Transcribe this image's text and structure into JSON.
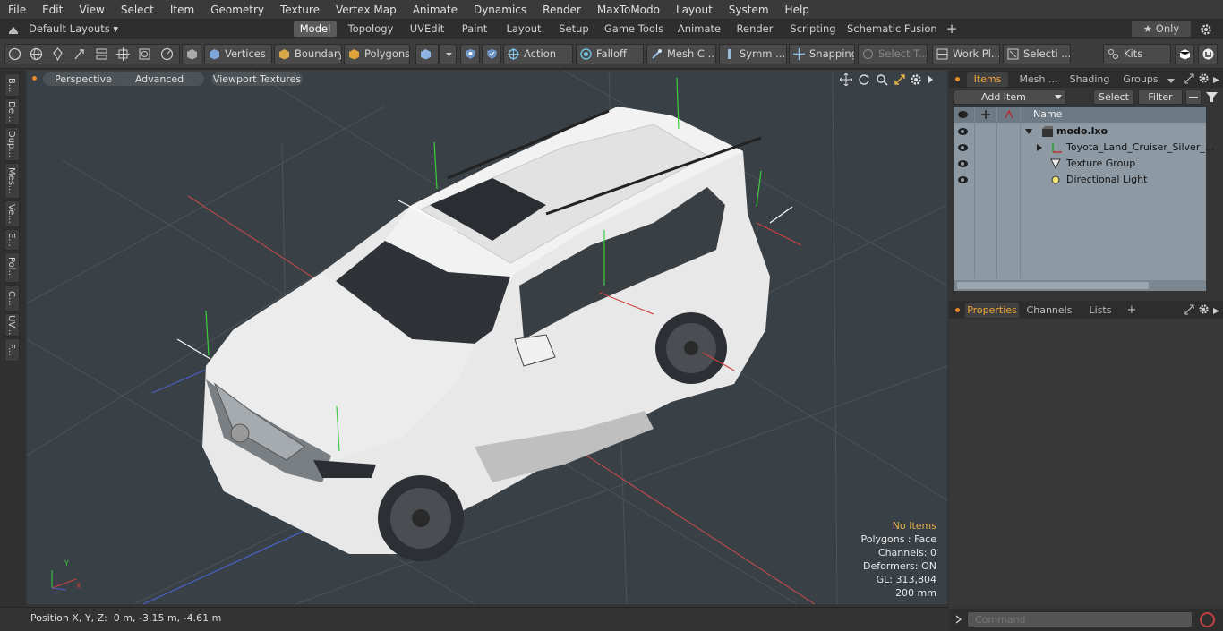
{
  "menu": [
    "File",
    "Edit",
    "View",
    "Select",
    "Item",
    "Geometry",
    "Texture",
    "Vertex Map",
    "Animate",
    "Dynamics",
    "Render",
    "MaxToModo",
    "Layout",
    "System",
    "Help"
  ],
  "layout_selector": "Default Layouts ▾",
  "layout_tabs": [
    "Model",
    "Topology",
    "UVEdit",
    "Paint",
    "Layout",
    "Setup",
    "Game Tools",
    "Animate",
    "Render",
    "Scripting",
    "Schematic Fusion"
  ],
  "only_label": "★ Only",
  "toolbar": {
    "vertices": "Vertices",
    "boundary": "Boundary",
    "polygons": "Polygons",
    "action": "Action",
    "falloff": "Falloff",
    "mesh": "Mesh C ...",
    "symm": "Symm ...",
    "snapping": "Snapping",
    "select_t": "Select T...",
    "work_pl": "Work Pl...",
    "selecti": "Selecti ...",
    "kits": "Kits"
  },
  "left_tabs": [
    "B...",
    "De...",
    "Dup...",
    "Mes...",
    "Ve...",
    "E...",
    "Pol...",
    "C...",
    "UV...",
    "F..."
  ],
  "viewport": {
    "perspective": "Perspective",
    "advanced": "Advanced",
    "viewport_textures": "Viewport Textures",
    "info": {
      "no_items": "No Items",
      "polygons": "Polygons : Face",
      "channels": "Channels: 0",
      "deformers": "Deformers: ON",
      "gl": "GL: 313,804",
      "scale": "200 mm"
    }
  },
  "status": {
    "position": "Position X, Y, Z:  0 m, -3.15 m, -4.61 m"
  },
  "items_panel": {
    "tabs": [
      "Items",
      "Mesh ...",
      "Shading",
      "Groups"
    ],
    "add_item": "Add Item",
    "select": "Select",
    "filter": "Filter",
    "name_header": "Name",
    "rows": [
      "modo.lxo",
      "Toyota_Land_Cruiser_Silver_...",
      "Texture Group",
      "Directional Light"
    ]
  },
  "props_panel": {
    "tabs": [
      "Properties",
      "Channels",
      "Lists"
    ]
  },
  "command": {
    "placeholder": "Command"
  }
}
